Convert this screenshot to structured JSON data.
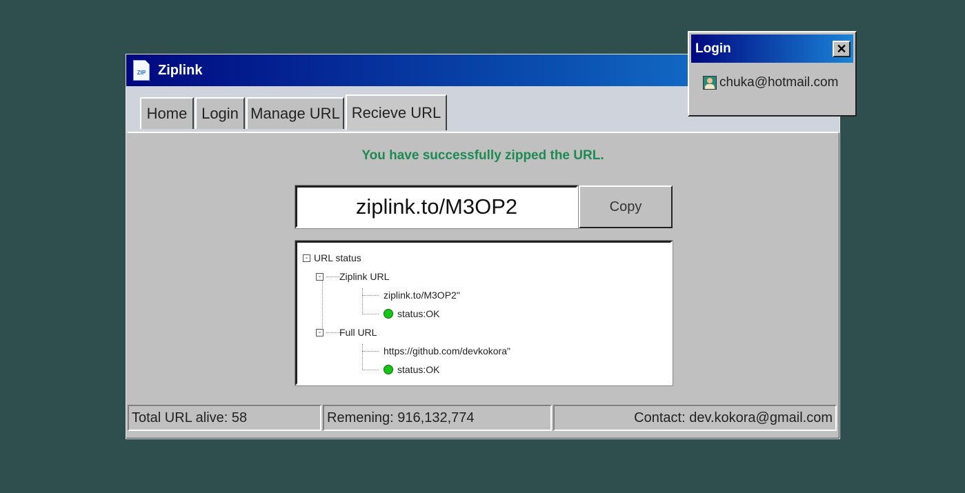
{
  "window": {
    "title": "Ziplink",
    "icon": "zip-file-icon",
    "icon_text": "ZIP"
  },
  "tabs": [
    {
      "label": "Home"
    },
    {
      "label": "Login"
    },
    {
      "label": "Manage URL"
    },
    {
      "label": "Recieve URL",
      "active": true
    }
  ],
  "main": {
    "success_message": "You have successfully zipped the URL.",
    "short_url": "ziplink.to/M3OP2",
    "copy_label": "Copy",
    "success_color": "#1e8a53"
  },
  "tree": {
    "root": {
      "label": "URL status",
      "toggle": "-"
    },
    "ziplink": {
      "label": "Ziplink URL",
      "toggle": "-",
      "value": "ziplink.to/M3OP2\"",
      "status": "status:OK"
    },
    "full": {
      "label": "Full URL",
      "toggle": "-",
      "value": "https://github.com/devkokora\"",
      "status": "status:OK"
    },
    "status_color": "#17c417"
  },
  "statusbar": {
    "alive": "Total URL alive: 58",
    "remaining": "Remening: 916,132,774",
    "contact": "Contact: dev.kokora@gmail.com"
  },
  "popup": {
    "title": "Login",
    "close_label": "✕",
    "user_email": "chuka@hotmail.com",
    "avatar_icon": "user-avatar-icon"
  }
}
